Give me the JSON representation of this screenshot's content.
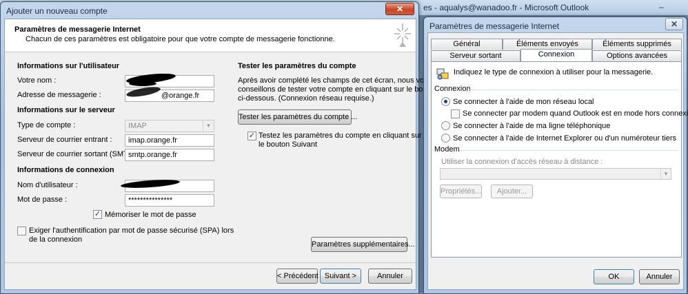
{
  "background": {
    "title": "es - aqualys@wanadoo.fr - Microsoft Outlook",
    "minimize_glyph": "–"
  },
  "left": {
    "title": "Ajouter un nouveau compte",
    "close_glyph": "✕",
    "header_title": "Paramètres de messagerie Internet",
    "header_desc": "Chacun de ces paramètres est obligatoire pour que votre compte de messagerie fonctionne.",
    "user_section": "Informations sur l'utilisateur",
    "name_label": "Votre nom :",
    "name_value": "",
    "email_label": "Adresse de messagerie :",
    "email_value": "@orange.fr",
    "server_section": "Informations sur le serveur",
    "account_type_label": "Type de compte :",
    "account_type_value": "IMAP",
    "incoming_label": "Serveur de courrier entrant :",
    "incoming_value": "imap.orange.fr",
    "outgoing_label": "Serveur de courrier sortant (SMTP) :",
    "outgoing_value": "smtp.orange.fr",
    "login_section": "Informations de connexion",
    "username_label": "Nom d'utilisateur :",
    "username_value": "",
    "password_label": "Mot de passe :",
    "password_value": "***************",
    "remember_label": "Mémoriser le mot de passe",
    "spa_label_1": "Exiger l'authentification par mot de passe sécurisé (SPA) lors",
    "spa_label_2": "de la connexion",
    "test_section": "Tester les paramètres du compte",
    "test_desc_1": "Après avoir complété les champs de cet écran, nous vous",
    "test_desc_2": "conseillons de tester votre compte en cliquant sur le bouton",
    "test_desc_3": "ci-dessous. (Connexion réseau requise.)",
    "test_button": "Tester les paramètres du compte ...",
    "test_next_label_1": "Testez les paramètres du compte en cliquant sur",
    "test_next_label_2": "le bouton Suivant",
    "more_settings_button": "Paramètres supplémentaires...",
    "back_button": "< Précédent",
    "next_button": "Suivant >",
    "cancel_button": "Annuler"
  },
  "right": {
    "title": "Paramètres de messagerie Internet",
    "close_glyph": "✕",
    "tabs_row1": [
      "Général",
      "Éléments envoyés",
      "Éléments supprimés"
    ],
    "tabs_row2": [
      "Serveur sortant",
      "Connexion",
      "Options avancées"
    ],
    "intro": "Indiquez le type de connexion à utiliser pour la messagerie.",
    "connection_group": "Connexion",
    "opt_lan": "Se connecter à l'aide de mon réseau local",
    "opt_modem_offline": "Se connecter par modem quand Outlook est en mode hors connexion",
    "opt_phone": "Se connecter à l'aide de ma ligne téléphonique",
    "opt_ie": "Se connecter à l'aide de Internet Explorer ou d'un numéroteur tiers",
    "modem_group": "Modem",
    "dialup_label": "Utiliser la connexion d'accès réseau à distance :",
    "properties_button": "Propriétés...",
    "add_button": "Ajouter...",
    "ok_button": "OK",
    "cancel_button": "Annuler"
  }
}
